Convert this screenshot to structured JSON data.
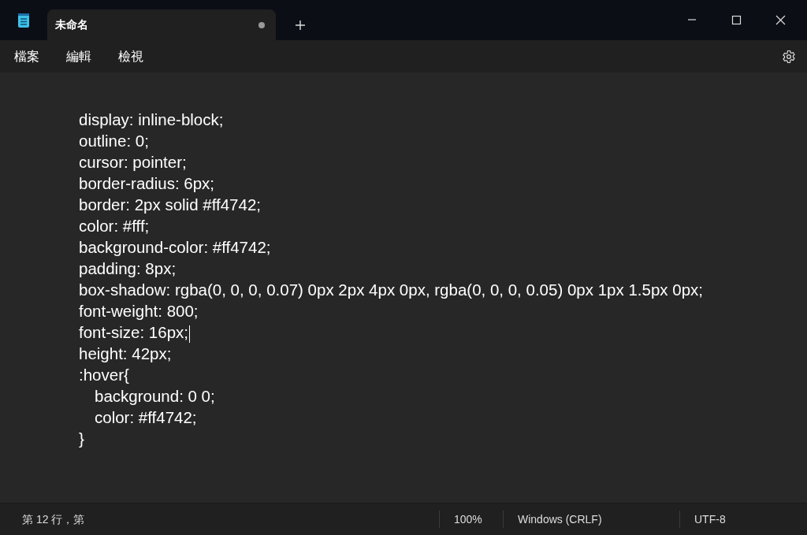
{
  "window": {
    "title": "未命名",
    "unsaved": true
  },
  "menu": [
    "檔案",
    "編輯",
    "檢視"
  ],
  "editor": {
    "lines": [
      {
        "text": "display: inline-block;",
        "cursor": false
      },
      {
        "text": "outline: 0;",
        "cursor": false
      },
      {
        "text": "cursor: pointer;",
        "cursor": false
      },
      {
        "text": "border-radius: 6px;",
        "cursor": false
      },
      {
        "text": "border: 2px solid #ff4742;",
        "cursor": false
      },
      {
        "text": "color: #fff;",
        "cursor": false
      },
      {
        "text": "background-color: #ff4742;",
        "cursor": false
      },
      {
        "text": "padding: 8px;",
        "cursor": false
      },
      {
        "text": "box-shadow: rgba(0, 0, 0, 0.07) 0px 2px 4px 0px, rgba(0, 0, 0, 0.05) 0px 1px 1.5px 0px;",
        "cursor": false
      },
      {
        "text": "font-weight: 800;",
        "cursor": false
      },
      {
        "text": "font-size: 16px;",
        "cursor": true
      },
      {
        "text": "height: 42px;",
        "cursor": false
      },
      {
        "text": ":hover{",
        "cursor": false,
        "children": [
          {
            "text": "background: 0 0;",
            "cursor": false
          },
          {
            "text": "color: #ff4742;",
            "cursor": false
          }
        ]
      },
      {
        "text": "}",
        "cursor": false
      }
    ]
  },
  "status_bar": {
    "position": "第 12 行，第",
    "zoom": "100%",
    "line_ending": "Windows (CRLF)",
    "encoding": "UTF-8"
  }
}
